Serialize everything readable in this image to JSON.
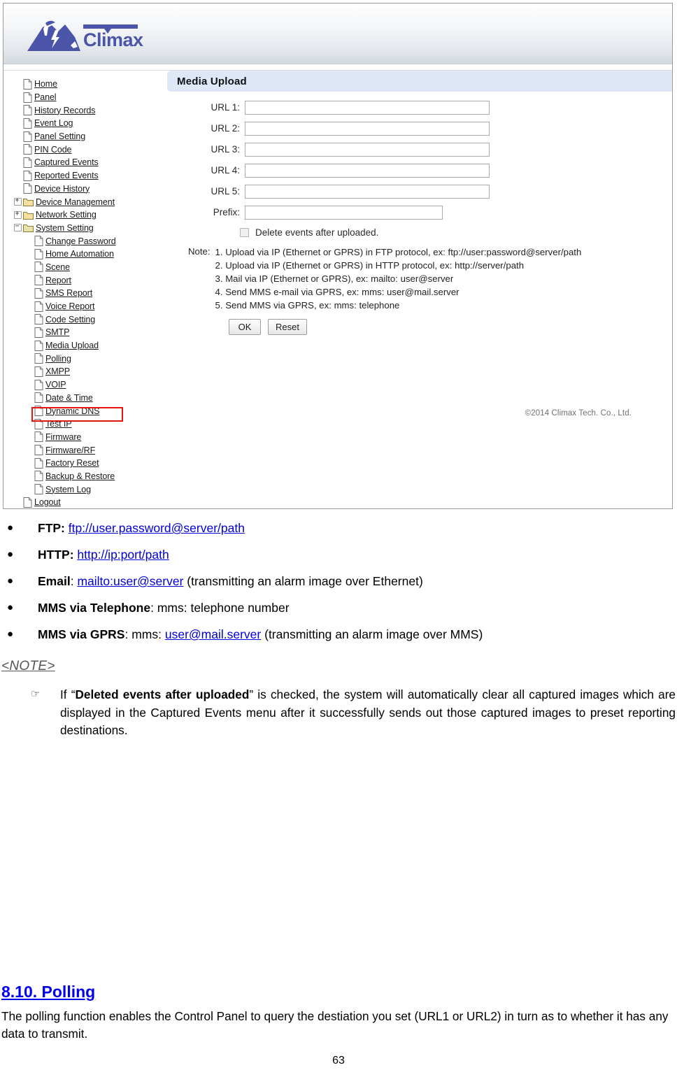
{
  "screenshot": {
    "brand": {
      "name": "Climax",
      "logo_color": "#4a54a8"
    },
    "sidebar": {
      "items": [
        {
          "label": "Home",
          "icon": "page-icon",
          "level": 0,
          "toggle": ""
        },
        {
          "label": "Panel",
          "icon": "page-icon",
          "level": 0,
          "toggle": ""
        },
        {
          "label": "History Records",
          "icon": "page-icon",
          "level": 0,
          "toggle": ""
        },
        {
          "label": "Event Log",
          "icon": "page-icon",
          "level": 0,
          "toggle": ""
        },
        {
          "label": "Panel Setting",
          "icon": "page-icon",
          "level": 0,
          "toggle": ""
        },
        {
          "label": "PIN Code",
          "icon": "page-icon",
          "level": 0,
          "toggle": ""
        },
        {
          "label": "Captured Events",
          "icon": "page-icon",
          "level": 0,
          "toggle": ""
        },
        {
          "label": "Reported Events",
          "icon": "page-icon",
          "level": 0,
          "toggle": ""
        },
        {
          "label": "Device History",
          "icon": "page-icon",
          "level": 0,
          "toggle": ""
        },
        {
          "label": "Device Management",
          "icon": "folder-icon",
          "level": 0,
          "toggle": "+"
        },
        {
          "label": "Network Setting",
          "icon": "folder-icon",
          "level": 0,
          "toggle": "+"
        },
        {
          "label": "System Setting",
          "icon": "folder-open-icon",
          "level": 0,
          "toggle": "−"
        },
        {
          "label": "Change Password",
          "icon": "page-icon",
          "level": 1,
          "toggle": ""
        },
        {
          "label": "Home Automation",
          "icon": "page-icon",
          "level": 1,
          "toggle": ""
        },
        {
          "label": "Scene",
          "icon": "page-icon",
          "level": 1,
          "toggle": ""
        },
        {
          "label": "Report",
          "icon": "page-icon",
          "level": 1,
          "toggle": ""
        },
        {
          "label": "SMS Report",
          "icon": "page-icon",
          "level": 1,
          "toggle": ""
        },
        {
          "label": "Voice Report",
          "icon": "page-icon",
          "level": 1,
          "toggle": ""
        },
        {
          "label": "Code Setting",
          "icon": "page-icon",
          "level": 1,
          "toggle": ""
        },
        {
          "label": "SMTP",
          "icon": "page-icon",
          "level": 1,
          "toggle": ""
        },
        {
          "label": "Media Upload",
          "icon": "page-icon",
          "level": 1,
          "toggle": "",
          "highlighted": true
        },
        {
          "label": "Polling",
          "icon": "page-icon",
          "level": 1,
          "toggle": ""
        },
        {
          "label": "XMPP",
          "icon": "page-icon",
          "level": 1,
          "toggle": ""
        },
        {
          "label": "VOIP",
          "icon": "page-icon",
          "level": 1,
          "toggle": ""
        },
        {
          "label": "Date & Time",
          "icon": "page-icon",
          "level": 1,
          "toggle": ""
        },
        {
          "label": "Dynamic DNS",
          "icon": "page-icon",
          "level": 1,
          "toggle": ""
        },
        {
          "label": "Test IP",
          "icon": "page-icon",
          "level": 1,
          "toggle": ""
        },
        {
          "label": "Firmware",
          "icon": "page-icon",
          "level": 1,
          "toggle": ""
        },
        {
          "label": "Firmware/RF",
          "icon": "page-icon",
          "level": 1,
          "toggle": ""
        },
        {
          "label": "Factory Reset",
          "icon": "page-icon",
          "level": 1,
          "toggle": ""
        },
        {
          "label": "Backup & Restore",
          "icon": "page-icon",
          "level": 1,
          "toggle": ""
        },
        {
          "label": "System Log",
          "icon": "page-icon",
          "level": 1,
          "toggle": ""
        },
        {
          "label": "Logout",
          "icon": "page-icon",
          "level": 0,
          "toggle": ""
        }
      ],
      "highlight_color": "#e8140c"
    },
    "panel": {
      "title": "Media Upload",
      "title_bar_color": "#dde7f8",
      "fields": [
        {
          "label": "URL 1:",
          "value": "",
          "placeholder": ""
        },
        {
          "label": "URL 2:",
          "value": "",
          "placeholder": ""
        },
        {
          "label": "URL 3:",
          "value": "",
          "placeholder": ""
        },
        {
          "label": "URL 4:",
          "value": "",
          "placeholder": ""
        },
        {
          "label": "URL 5:",
          "value": "",
          "placeholder": ""
        }
      ],
      "prefix_field": {
        "label": "Prefix:",
        "value": "",
        "placeholder": ""
      },
      "checkbox": {
        "label": "Delete events after uploaded.",
        "checked": false
      },
      "note_label": "Note:",
      "notes": [
        "1. Upload via IP (Ethernet or GPRS) in FTP protocol, ex: ftp://user:password@server/path",
        "2. Upload via IP (Ethernet or GPRS) in HTTP protocol, ex: http://server/path",
        "3. Mail via IP (Ethernet or GPRS), ex: mailto: user@server",
        "4. Send MMS e-mail via GPRS, ex: mms: user@mail.server",
        "5. Send MMS via GPRS, ex: mms: telephone"
      ],
      "buttons": {
        "ok": "OK",
        "reset": "Reset"
      },
      "copyright": "©2014 Climax Tech. Co., Ltd."
    }
  },
  "document": {
    "bullets": [
      {
        "term": "FTP:",
        "term_bold": true,
        "link": "ftp://user.password@server/path",
        "tail": ""
      },
      {
        "term": "HTTP:",
        "term_bold": true,
        "link": "http://ip:port/path",
        "tail": ""
      },
      {
        "term": "Email",
        "term_bold": true,
        "separator": ": ",
        "link": "mailto:user@server",
        "tail": " (transmitting an alarm image over Ethernet)"
      },
      {
        "term": "MMS via Telephone",
        "term_bold": true,
        "separator": ": ",
        "link": "",
        "tail": "mms: telephone number"
      },
      {
        "term": "MMS via GPRS",
        "term_bold": true,
        "separator": ": ",
        "pre": "mms: ",
        "link": "user@mail.server",
        "tail": " (transmitting an alarm image over MMS)"
      }
    ],
    "note_heading": "<NOTE>",
    "note_pointer": "☞",
    "note_text_start": "If “",
    "note_text_bold": "Deleted events after uploaded",
    "note_text_end": "” is checked, the system will automatically clear all captured images which are displayed in the Captured Events menu after it successfully sends out those captured images to preset reporting destinations.",
    "section_heading": "8.10. Polling",
    "section_paragraph": "The polling function enables the Control Panel to query the destiation you set (URL1 or URL2) in turn as to whether it has any data to transmit.",
    "page_number": "63",
    "link_color": "#0000d8",
    "heading_color": "#0000ee"
  }
}
